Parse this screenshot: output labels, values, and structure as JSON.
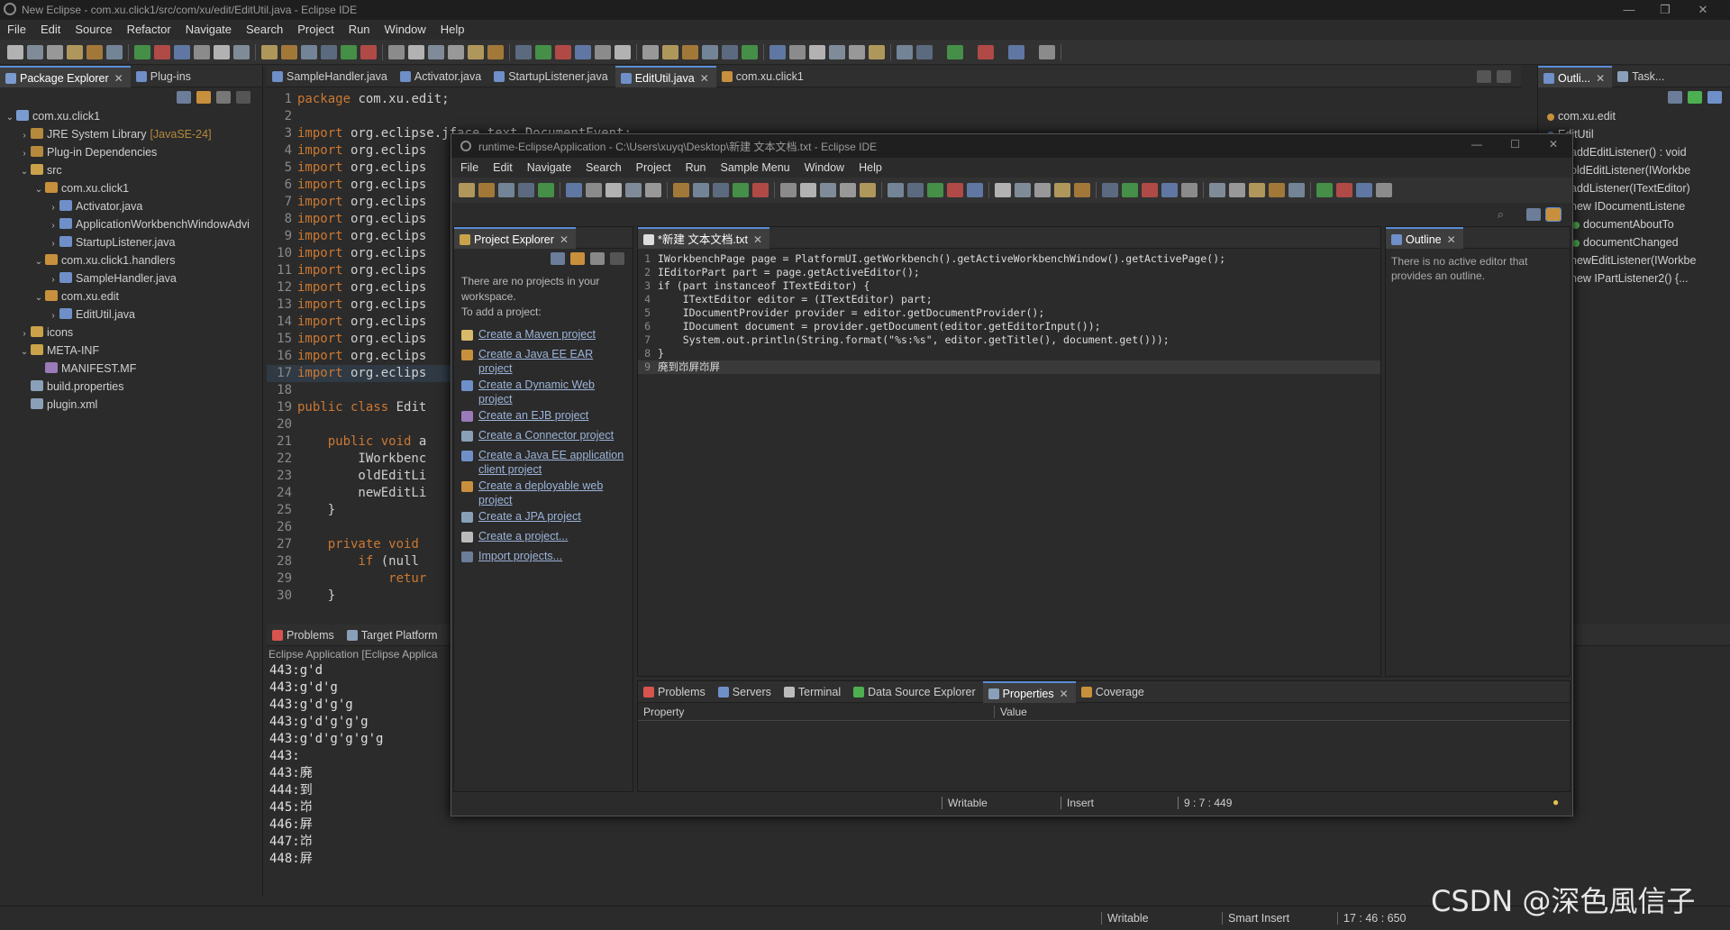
{
  "window": {
    "title": "New Eclipse - com.xu.click1/src/com/xu/edit/EditUtil.java - Eclipse IDE",
    "controls": [
      "—",
      "❐",
      "✕"
    ]
  },
  "menubar": [
    "File",
    "Edit",
    "Source",
    "Refactor",
    "Navigate",
    "Search",
    "Project",
    "Run",
    "Window",
    "Help"
  ],
  "left_tabs": {
    "package_explorer": "Package Explorer",
    "plugins": "Plug-ins"
  },
  "tree": [
    {
      "label": "com.xu.click1",
      "arrow": "⌄",
      "indent": 0,
      "icon": "project-icon",
      "color": "#7a9bd0"
    },
    {
      "label": "JRE System Library",
      "suffix": "[JavaSE-24]",
      "arrow": "›",
      "indent": 1,
      "icon": "library-icon",
      "color": "#b58a3c"
    },
    {
      "label": "Plug-in Dependencies",
      "arrow": "›",
      "indent": 1,
      "icon": "library-icon",
      "color": "#b58a3c"
    },
    {
      "label": "src",
      "arrow": "⌄",
      "indent": 1,
      "icon": "folder-icon",
      "color": "#c9a24a"
    },
    {
      "label": "com.xu.click1",
      "arrow": "⌄",
      "indent": 2,
      "icon": "package-icon",
      "color": "#c8903c"
    },
    {
      "label": "Activator.java",
      "arrow": "›",
      "indent": 3,
      "icon": "java-file-icon",
      "color": "#6f8fc8"
    },
    {
      "label": "ApplicationWorkbenchWindowAdvi",
      "arrow": "›",
      "indent": 3,
      "icon": "java-file-icon",
      "color": "#6f8fc8"
    },
    {
      "label": "StartupListener.java",
      "arrow": "›",
      "indent": 3,
      "icon": "java-file-icon",
      "color": "#6f8fc8"
    },
    {
      "label": "com.xu.click1.handlers",
      "arrow": "⌄",
      "indent": 2,
      "icon": "package-icon",
      "color": "#c8903c"
    },
    {
      "label": "SampleHandler.java",
      "arrow": "›",
      "indent": 3,
      "icon": "java-file-icon",
      "color": "#6f8fc8"
    },
    {
      "label": "com.xu.edit",
      "arrow": "⌄",
      "indent": 2,
      "icon": "package-icon",
      "color": "#c8903c"
    },
    {
      "label": "EditUtil.java",
      "arrow": "›",
      "indent": 3,
      "icon": "java-file-icon",
      "color": "#6f8fc8"
    },
    {
      "label": "icons",
      "arrow": "›",
      "indent": 1,
      "icon": "folder-icon",
      "color": "#c9a24a"
    },
    {
      "label": "META-INF",
      "arrow": "⌄",
      "indent": 1,
      "icon": "folder-icon",
      "color": "#c9a24a"
    },
    {
      "label": "MANIFEST.MF",
      "arrow": "",
      "indent": 2,
      "icon": "manifest-icon",
      "color": "#9a7ab8"
    },
    {
      "label": "build.properties",
      "arrow": "",
      "indent": 1,
      "icon": "properties-icon",
      "color": "#8aa0b8"
    },
    {
      "label": "plugin.xml",
      "arrow": "",
      "indent": 1,
      "icon": "xml-icon",
      "color": "#8aa0b8"
    }
  ],
  "editor_tabs": [
    {
      "label": "SampleHandler.java",
      "active": false
    },
    {
      "label": "Activator.java",
      "active": false
    },
    {
      "label": "StartupListener.java",
      "active": false
    },
    {
      "label": "EditUtil.java",
      "active": true
    },
    {
      "label": "com.xu.click1",
      "active": false
    }
  ],
  "code": [
    {
      "n": "1",
      "kw": "package",
      "rest": " com.xu.edit;"
    },
    {
      "n": "2",
      "kw": "",
      "rest": ""
    },
    {
      "n": "3",
      "kw": "import",
      "rest": " org.eclipse.jface.text.DocumentEvent;"
    },
    {
      "n": "4",
      "kw": "import",
      "rest": " org.eclips"
    },
    {
      "n": "5",
      "kw": "import",
      "rest": " org.eclips"
    },
    {
      "n": "6",
      "kw": "import",
      "rest": " org.eclips"
    },
    {
      "n": "7",
      "kw": "import",
      "rest": " org.eclips"
    },
    {
      "n": "8",
      "kw": "import",
      "rest": " org.eclips"
    },
    {
      "n": "9",
      "kw": "import",
      "rest": " org.eclips"
    },
    {
      "n": "10",
      "kw": "import",
      "rest": " org.eclips"
    },
    {
      "n": "11",
      "kw": "import",
      "rest": " org.eclips"
    },
    {
      "n": "12",
      "kw": "import",
      "rest": " org.eclips"
    },
    {
      "n": "13",
      "kw": "import",
      "rest": " org.eclips"
    },
    {
      "n": "14",
      "kw": "import",
      "rest": " org.eclips"
    },
    {
      "n": "15",
      "kw": "import",
      "rest": " org.eclips"
    },
    {
      "n": "16",
      "kw": "import",
      "rest": " org.eclips"
    },
    {
      "n": "17",
      "kw": "import",
      "rest": " org.eclips"
    },
    {
      "n": "18",
      "kw": "",
      "rest": ""
    },
    {
      "n": "19",
      "kw": "public class",
      "rest": " Edit"
    },
    {
      "n": "20",
      "kw": "",
      "rest": ""
    },
    {
      "n": "21",
      "kw": "    public void",
      "rest": " a"
    },
    {
      "n": "22",
      "kw": "",
      "rest": "        IWorkbenc"
    },
    {
      "n": "23",
      "kw": "",
      "rest": "        oldEditLi"
    },
    {
      "n": "24",
      "kw": "",
      "rest": "        newEditLi"
    },
    {
      "n": "25",
      "kw": "",
      "rest": "    }"
    },
    {
      "n": "26",
      "kw": "",
      "rest": ""
    },
    {
      "n": "27",
      "kw": "    private void",
      "rest": ""
    },
    {
      "n": "28",
      "kw": "        if",
      "rest": " (null"
    },
    {
      "n": "29",
      "kw": "            retur",
      "rest": ""
    },
    {
      "n": "30",
      "kw": "",
      "rest": "    }"
    }
  ],
  "right_tabs": {
    "outline": "Outli...",
    "task": "Task..."
  },
  "outline_items": [
    {
      "label": "com.xu.edit",
      "color": "#c8903c"
    },
    {
      "label": "EditUtil",
      "color": "#6f8fc8"
    },
    {
      "label": "addEditListener() : void",
      "color": "#4caf50"
    },
    {
      "label": "oldEditListener(IWorkbe",
      "color": "#d9534f"
    },
    {
      "label": "addListener(ITextEditor)",
      "color": "#d9534f"
    },
    {
      "label": "new IDocumentListene",
      "color": "#6f8fc8"
    },
    {
      "label": "documentAboutTo",
      "color": "#4caf50"
    },
    {
      "label": "documentChanged",
      "color": "#4caf50"
    },
    {
      "label": "newEditListener(IWorkbe",
      "color": "#d9534f"
    },
    {
      "label": "new IPartListener2() {...",
      "color": "#6f8fc8"
    }
  ],
  "bottom_tabs": {
    "problems": "Problems",
    "target_platform": "Target Platform"
  },
  "console": {
    "header": "Eclipse Application [Eclipse Applica",
    "lines": [
      "443:g'd",
      "443:g'd'g",
      "443:g'd'g'g",
      "443:g'd'g'g'g",
      "443:g'd'g'g'g'g",
      "443:",
      "443:廃",
      "444:到",
      "445:岇",
      "446:屛",
      "447:岇",
      "448:屛"
    ]
  },
  "status": {
    "writable": "Writable",
    "insert": "Smart Insert",
    "position": "17 : 46 : 650"
  },
  "watermark": "CSDN @深色風信子",
  "runtime": {
    "title": "runtime-EclipseApplication - C:\\Users\\xuyq\\Desktop\\新建 文本文档.txt - Eclipse IDE",
    "menubar": [
      "File",
      "Edit",
      "Navigate",
      "Search",
      "Project",
      "Run",
      "Sample Menu",
      "Window",
      "Help"
    ],
    "project_explorer": {
      "tab": "Project Explorer",
      "empty1": "There are no projects in your workspace.",
      "empty2": "To add a project:",
      "links": [
        "Create a Maven project",
        "Create a Java EE EAR project",
        "Create a Dynamic Web project",
        "Create an EJB project",
        "Create a Connector project",
        "Create a Java EE application client project",
        "Create a deployable web project",
        "Create a JPA project",
        "Create a project...",
        "Import projects..."
      ]
    },
    "editor_tab": "*新建 文本文档.txt",
    "code": [
      {
        "n": "1",
        "t": "IWorkbenchPage page = PlatformUI.getWorkbench().getActiveWorkbenchWindow().getActivePage();"
      },
      {
        "n": "2",
        "t": "IEditorPart part = page.getActiveEditor();"
      },
      {
        "n": "3",
        "t": "if (part instanceof ITextEditor) {"
      },
      {
        "n": "4",
        "t": "    ITextEditor editor = (ITextEditor) part;"
      },
      {
        "n": "5",
        "t": "    IDocumentProvider provider = editor.getDocumentProvider();"
      },
      {
        "n": "6",
        "t": "    IDocument document = provider.getDocument(editor.getEditorInput());"
      },
      {
        "n": "7",
        "t": "    System.out.println(String.format(\"%s:%s\", editor.getTitle(), document.get()));"
      },
      {
        "n": "8",
        "t": "}"
      },
      {
        "n": "9",
        "t": "廃到岇屛岇屛"
      }
    ],
    "outline": {
      "tab": "Outline",
      "message": "There is no active editor that provides an outline."
    },
    "bottom_tabs": [
      "Problems",
      "Servers",
      "Terminal",
      "Data Source Explorer",
      "Properties",
      "Coverage"
    ],
    "properties": {
      "col1": "Property",
      "col2": "Value"
    },
    "status": {
      "writable": "Writable",
      "insert": "Insert",
      "position": "9 : 7 : 449"
    }
  },
  "colors": {
    "accent": "#5a8dd6",
    "bg": "#2b2b2b",
    "keyword": "#cc7832"
  }
}
